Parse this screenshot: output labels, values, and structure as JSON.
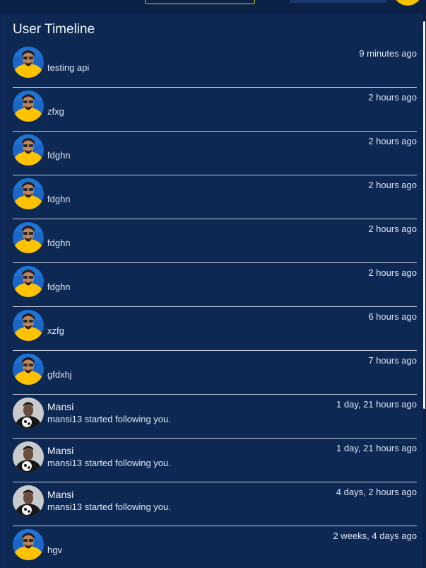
{
  "timeline": {
    "title": "User Timeline",
    "items": [
      {
        "type": "post",
        "avatar": "yellow-hoodie-avatar",
        "name": "",
        "text": "testing api",
        "time": "9 minutes ago"
      },
      {
        "type": "post",
        "avatar": "yellow-hoodie-avatar",
        "name": "",
        "text": "zfxg",
        "time": "2 hours ago"
      },
      {
        "type": "post",
        "avatar": "yellow-hoodie-avatar",
        "name": "",
        "text": "fdghn",
        "time": "2 hours ago"
      },
      {
        "type": "post",
        "avatar": "yellow-hoodie-avatar",
        "name": "",
        "text": "fdghn",
        "time": "2 hours ago"
      },
      {
        "type": "post",
        "avatar": "yellow-hoodie-avatar",
        "name": "",
        "text": "fdghn",
        "time": "2 hours ago"
      },
      {
        "type": "post",
        "avatar": "yellow-hoodie-avatar",
        "name": "",
        "text": "fdghn",
        "time": "2 hours ago"
      },
      {
        "type": "post",
        "avatar": "yellow-hoodie-avatar",
        "name": "",
        "text": "xzfg",
        "time": "6 hours ago"
      },
      {
        "type": "post",
        "avatar": "yellow-hoodie-avatar",
        "name": "",
        "text": "gfdxhj",
        "time": "7 hours ago"
      },
      {
        "type": "follow",
        "avatar": "soccer-player-avatar",
        "name": "Mansi",
        "text": "mansi13 started following you.",
        "time": "1 day, 21 hours ago"
      },
      {
        "type": "follow",
        "avatar": "soccer-player-avatar",
        "name": "Mansi",
        "text": "mansi13 started following you.",
        "time": "1 day, 21 hours ago"
      },
      {
        "type": "follow",
        "avatar": "soccer-player-avatar",
        "name": "Mansi",
        "text": "mansi13 started following you.",
        "time": "4 days, 2 hours ago"
      },
      {
        "type": "post",
        "avatar": "yellow-hoodie-avatar",
        "name": "",
        "text": "hgv",
        "time": "2 weeks, 4 days ago"
      }
    ]
  },
  "colors": {
    "background": "#0c2146",
    "panel": "#0c2853",
    "divider": "#c3cddd",
    "text": "#dfe6f2",
    "accent_yellow": "#f2c100"
  }
}
